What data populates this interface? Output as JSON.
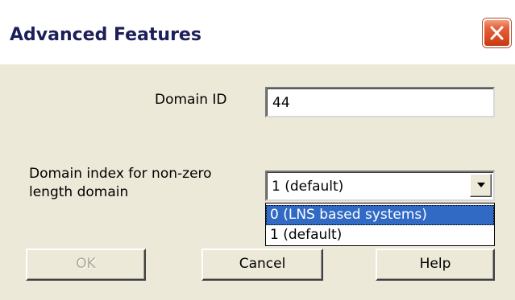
{
  "window": {
    "title": "Advanced Features"
  },
  "icons": {
    "close": "close-icon",
    "dropdown": "chevron-down-icon"
  },
  "colors": {
    "title_text": "#1c1f5a",
    "close_button": "#d84a22",
    "dialog_background": "#ece9d8",
    "selection": "#316ac5"
  },
  "form": {
    "domain_id": {
      "label": "Domain ID",
      "value": "44"
    },
    "domain_index": {
      "label_line1": "Domain index for non-zero",
      "label_line2": "length domain",
      "selected_value": "1 (default)",
      "options": [
        {
          "label": "0 (LNS based systems)",
          "highlighted": true
        },
        {
          "label": "1 (default)",
          "highlighted": false
        }
      ]
    }
  },
  "buttons": {
    "ok": {
      "label": "OK",
      "enabled": false
    },
    "cancel": {
      "label": "Cancel",
      "enabled": true
    },
    "help": {
      "label": "Help",
      "enabled": true
    }
  }
}
